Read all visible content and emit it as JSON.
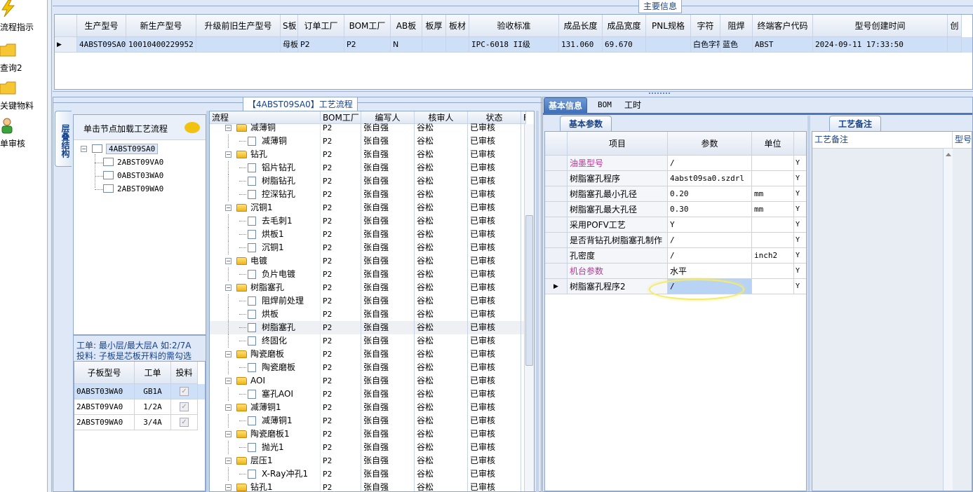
{
  "left_nav": {
    "items": [
      {
        "label": "流程指示",
        "icon": "lightning-icon"
      },
      {
        "label": "查询2",
        "icon": "folder-icon"
      },
      {
        "label": "关键物料",
        "icon": "folder-icon"
      },
      {
        "label": "单审核",
        "icon": "user-icon"
      }
    ]
  },
  "main_info": {
    "title": "主要信息",
    "columns": [
      "生产型号",
      "新生产型号",
      "升级前旧生产型号",
      "S板",
      "订单工厂",
      "BOM工厂",
      "AB板",
      "板厚",
      "板材",
      "验收标准",
      "成品长度",
      "成品宽度",
      "PNL规格",
      "字符",
      "阻焊",
      "终端客户代码",
      "型号创建时间",
      "创"
    ],
    "row": [
      "4ABST09SA0",
      "10010400229952",
      "",
      "母板",
      "P2",
      "P2",
      "N",
      "",
      "",
      "IPC-6018 II级",
      "131.060",
      "69.670",
      "",
      "白色字符",
      "蓝色",
      "ABST",
      "2024-09-11 17:33:50",
      ""
    ]
  },
  "process_panel": {
    "title": "【4ABST09SA0】工艺流程",
    "vertical_tab": "层叠结构",
    "hint": "单击节点加载工艺流程",
    "tree": [
      {
        "label": "4ABST09SA0",
        "level": 0
      },
      {
        "label": "2ABST09VA0",
        "level": 1
      },
      {
        "label": "0ABST03WA0",
        "level": 1
      },
      {
        "label": "2ABST09WA0",
        "level": 1
      }
    ],
    "info_line1": "工单: 最小层/最大层A 如:2/7A",
    "info_line2": "投料: 子板是芯板开料的需勾选",
    "layer_columns": [
      "子板型号",
      "工单",
      "投料"
    ],
    "layer_rows": [
      {
        "model": "0ABST03WA0",
        "order": "GB1A"
      },
      {
        "model": "2ABST09VA0",
        "order": "1/2A"
      },
      {
        "model": "2ABST09WA0",
        "order": "3/4A"
      }
    ]
  },
  "flow_table": {
    "columns": [
      "流程",
      "BOM工厂",
      "编写人",
      "核审人",
      "状态",
      "F"
    ],
    "rows": [
      {
        "name": "减薄铜",
        "type": "group",
        "bom": "P2",
        "writer": "张自强",
        "reviewer": "谷松",
        "status": "已审核"
      },
      {
        "name": "减薄铜",
        "type": "item",
        "bom": "P2",
        "writer": "张自强",
        "reviewer": "谷松",
        "status": "已审核"
      },
      {
        "name": "钻孔",
        "type": "group",
        "bom": "P2",
        "writer": "张自强",
        "reviewer": "谷松",
        "status": "已审核"
      },
      {
        "name": "铝片钻孔",
        "type": "item",
        "bom": "P2",
        "writer": "张自强",
        "reviewer": "谷松",
        "status": "已审核"
      },
      {
        "name": "树脂钻孔",
        "type": "item",
        "bom": "P2",
        "writer": "张自强",
        "reviewer": "谷松",
        "status": "已审核"
      },
      {
        "name": "控深钻孔",
        "type": "item",
        "bom": "P2",
        "writer": "张自强",
        "reviewer": "谷松",
        "status": "已审核"
      },
      {
        "name": "沉铜1",
        "type": "group",
        "bom": "P2",
        "writer": "张自强",
        "reviewer": "谷松",
        "status": "已审核"
      },
      {
        "name": "去毛刺1",
        "type": "item",
        "bom": "P2",
        "writer": "张自强",
        "reviewer": "谷松",
        "status": "已审核"
      },
      {
        "name": "烘板1",
        "type": "item",
        "bom": "P2",
        "writer": "张自强",
        "reviewer": "谷松",
        "status": "已审核"
      },
      {
        "name": "沉铜1",
        "type": "item",
        "bom": "P2",
        "writer": "张自强",
        "reviewer": "谷松",
        "status": "已审核"
      },
      {
        "name": "电镀",
        "type": "group",
        "bom": "P2",
        "writer": "张自强",
        "reviewer": "谷松",
        "status": "已审核"
      },
      {
        "name": "负片电镀",
        "type": "item",
        "bom": "P2",
        "writer": "张自强",
        "reviewer": "谷松",
        "status": "已审核"
      },
      {
        "name": "树脂塞孔",
        "type": "group",
        "bom": "P2",
        "writer": "张自强",
        "reviewer": "谷松",
        "status": "已审核"
      },
      {
        "name": "阻焊前处理",
        "type": "item",
        "bom": "P2",
        "writer": "张自强",
        "reviewer": "谷松",
        "status": "已审核"
      },
      {
        "name": "烘板",
        "type": "item",
        "bom": "P2",
        "writer": "张自强",
        "reviewer": "谷松",
        "status": "已审核"
      },
      {
        "name": "树脂塞孔",
        "type": "item",
        "bom": "P2",
        "writer": "张自强",
        "reviewer": "谷松",
        "status": "已审核",
        "selected": true
      },
      {
        "name": "终固化",
        "type": "item",
        "bom": "P2",
        "writer": "张自强",
        "reviewer": "谷松",
        "status": "已审核"
      },
      {
        "name": "陶瓷磨板",
        "type": "group",
        "bom": "P2",
        "writer": "张自强",
        "reviewer": "谷松",
        "status": "已审核"
      },
      {
        "name": "陶瓷磨板",
        "type": "item",
        "bom": "P2",
        "writer": "张自强",
        "reviewer": "谷松",
        "status": "已审核"
      },
      {
        "name": "AOI",
        "type": "group",
        "bom": "P2",
        "writer": "张自强",
        "reviewer": "谷松",
        "status": "已审核"
      },
      {
        "name": "塞孔AOI",
        "type": "item",
        "bom": "P2",
        "writer": "张自强",
        "reviewer": "谷松",
        "status": "已审核"
      },
      {
        "name": "减薄铜1",
        "type": "group",
        "bom": "P2",
        "writer": "张自强",
        "reviewer": "谷松",
        "status": "已审核"
      },
      {
        "name": "减薄铜1",
        "type": "item",
        "bom": "P2",
        "writer": "张自强",
        "reviewer": "谷松",
        "status": "已审核"
      },
      {
        "name": "陶瓷磨板1",
        "type": "group",
        "bom": "P2",
        "writer": "张自强",
        "reviewer": "谷松",
        "status": "已审核"
      },
      {
        "name": "抛光1",
        "type": "item",
        "bom": "P2",
        "writer": "张自强",
        "reviewer": "谷松",
        "status": "已审核"
      },
      {
        "name": "层压1",
        "type": "group",
        "bom": "P2",
        "writer": "张自强",
        "reviewer": "谷松",
        "status": "已审核"
      },
      {
        "name": "X-Ray冲孔1",
        "type": "item",
        "bom": "P2",
        "writer": "张自强",
        "reviewer": "谷松",
        "status": "已审核"
      },
      {
        "name": "钻孔1",
        "type": "group",
        "bom": "P2",
        "writer": "张自强",
        "reviewer": "谷松",
        "status": "已审核"
      }
    ]
  },
  "right_panel": {
    "tabs": [
      "基本信息",
      "BOM",
      "工时"
    ],
    "sub_tab": "基本参数",
    "param_columns": [
      "项目",
      "参数",
      "单位"
    ],
    "params": [
      {
        "item": "油墨型号",
        "value": "/",
        "unit": "",
        "flag": "Y",
        "highlight": true
      },
      {
        "item": "树脂塞孔程序",
        "value": "4abst09sa0.szdrl",
        "unit": "",
        "flag": "Y"
      },
      {
        "item": "树脂塞孔最小孔径",
        "value": "0.20",
        "unit": "mm",
        "flag": "Y"
      },
      {
        "item": "树脂塞孔最大孔径",
        "value": "0.30",
        "unit": "mm",
        "flag": "Y"
      },
      {
        "item": "采用POFV工艺",
        "value": "Y",
        "unit": "",
        "flag": "Y"
      },
      {
        "item": "是否背钻孔树脂塞孔制作",
        "value": "/",
        "unit": "",
        "flag": "Y"
      },
      {
        "item": "孔密度",
        "value": "/",
        "unit": "inch2",
        "flag": "Y"
      },
      {
        "item": "机台参数",
        "value": "水平",
        "unit": "",
        "flag": "Y",
        "highlight": true
      },
      {
        "item": "树脂塞孔程序2",
        "value": "/",
        "unit": "",
        "flag": "Y",
        "current": true
      }
    ],
    "remark_tab": "工艺备注",
    "remark_columns": [
      "工艺备注",
      "型号备"
    ]
  },
  "colors": {
    "accent": "#15428b",
    "highlight_text": "#c0309c",
    "selection": "#cde0f8"
  }
}
